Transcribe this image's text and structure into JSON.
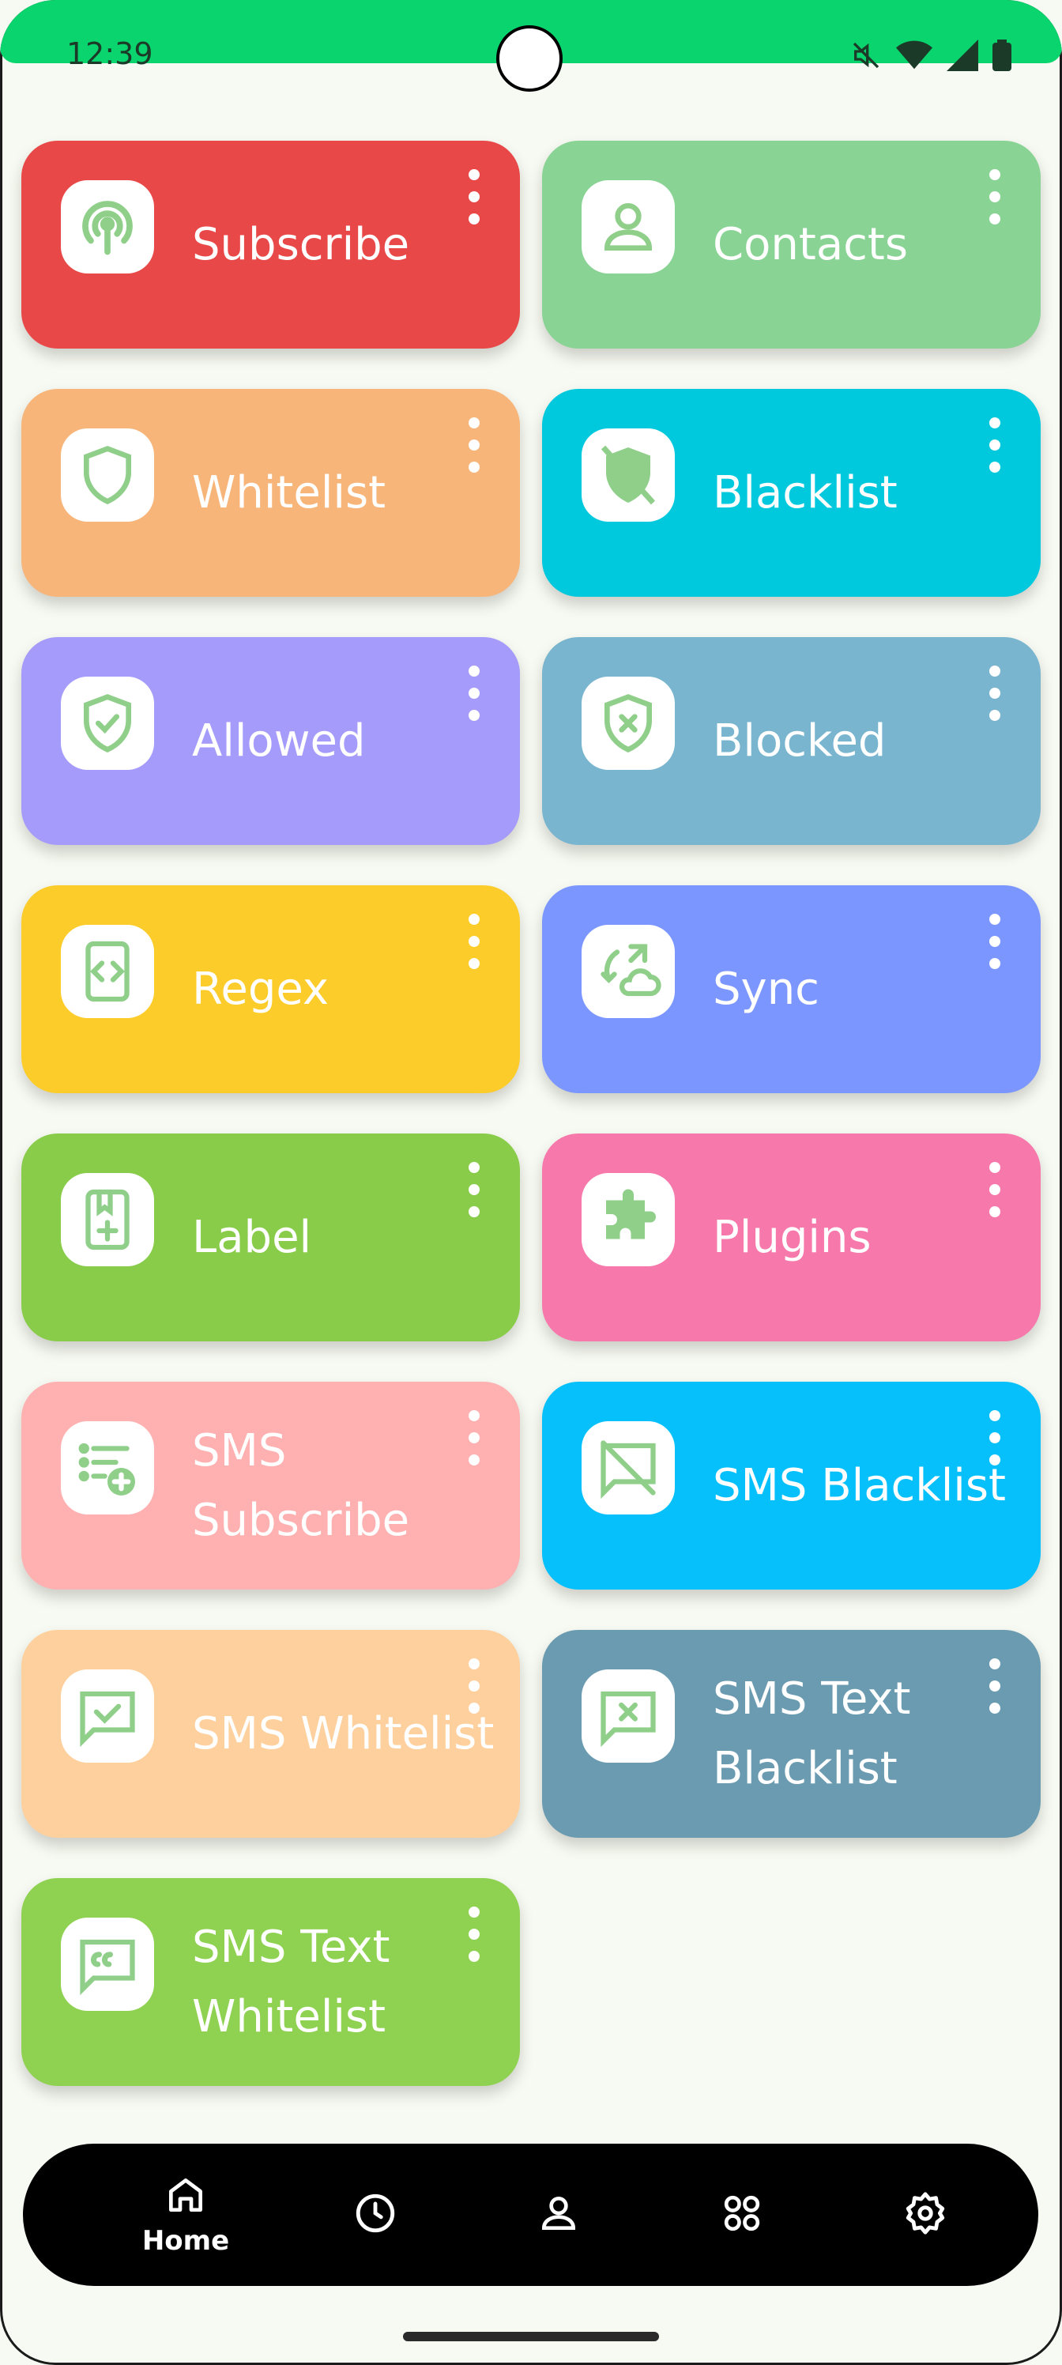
{
  "status_bar": {
    "time": "12:39"
  },
  "tiles": [
    {
      "label": "Subscribe",
      "color": "#e84848",
      "icon": "podcast-icon"
    },
    {
      "label": "Contacts",
      "color": "#89d394",
      "icon": "person-icon"
    },
    {
      "label": "Whitelist",
      "color": "#f7b57a",
      "icon": "shield-icon"
    },
    {
      "label": "Blacklist",
      "color": "#00c8dd",
      "icon": "shield-off-icon"
    },
    {
      "label": "Allowed",
      "color": "#a59bfa",
      "icon": "shield-check-icon"
    },
    {
      "label": "Blocked",
      "color": "#79b5cf",
      "icon": "shield-x-icon"
    },
    {
      "label": "Regex",
      "color": "#fccc2b",
      "icon": "code-icon"
    },
    {
      "label": "Sync",
      "color": "#7b96ff",
      "icon": "cloud-sync-icon"
    },
    {
      "label": "Label",
      "color": "#88cc4a",
      "icon": "bookmark-add-icon"
    },
    {
      "label": "Plugins",
      "color": "#f778ab",
      "icon": "puzzle-icon"
    },
    {
      "label": "SMS Subscribe",
      "color": "#ffb0b0",
      "icon": "list-add-icon"
    },
    {
      "label": "SMS Blacklist",
      "color": "#06c0fb",
      "icon": "message-off-icon"
    },
    {
      "label": "SMS Whitelist",
      "color": "#fed09e",
      "icon": "message-check-icon"
    },
    {
      "label": "SMS Text Blacklist",
      "color": "#6b9bb1",
      "icon": "message-x-icon"
    },
    {
      "label": "SMS Text Whitelist",
      "color": "#8fd150",
      "icon": "message-quote-icon"
    }
  ],
  "icon_color": "#8fcf8a",
  "bottom_nav": {
    "items": [
      {
        "label": "Home",
        "icon": "home-icon"
      },
      {
        "label": "",
        "icon": "history-icon"
      },
      {
        "label": "",
        "icon": "person-icon"
      },
      {
        "label": "",
        "icon": "apps-icon"
      },
      {
        "label": "",
        "icon": "settings-icon"
      }
    ]
  }
}
